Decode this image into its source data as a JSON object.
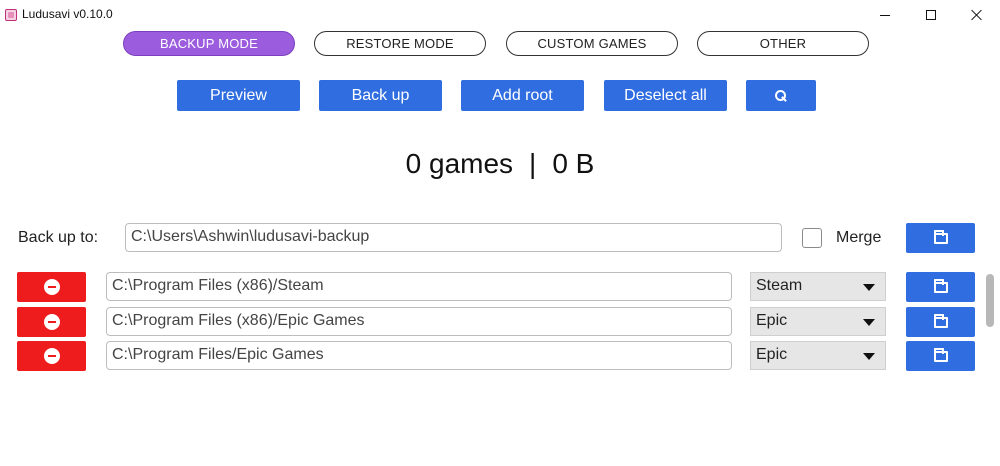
{
  "window": {
    "title": "Ludusavi v0.10.0",
    "icons": {
      "app": "app-icon",
      "minimize": "minimize-icon",
      "maximize": "maximize-icon",
      "close": "close-icon"
    }
  },
  "modes": [
    {
      "label": "BACKUP MODE",
      "active": true
    },
    {
      "label": "RESTORE MODE",
      "active": false
    },
    {
      "label": "CUSTOM GAMES",
      "active": false
    },
    {
      "label": "OTHER",
      "active": false
    }
  ],
  "actions": {
    "preview": "Preview",
    "back_up": "Back up",
    "add_root": "Add root",
    "deselect_all": "Deselect all",
    "search_icon": "search-icon"
  },
  "summary": {
    "games": "0 games",
    "separator": "|",
    "size": "0 B"
  },
  "backup_target": {
    "label": "Back up to:",
    "path": "C:\\Users\\Ashwin\\ludusavi-backup",
    "merge_label": "Merge",
    "merge_checked": false,
    "browse_icon": "folder-icon"
  },
  "roots": [
    {
      "path": "C:\\Program Files (x86)/Steam",
      "store": "Steam"
    },
    {
      "path": "C:\\Program Files (x86)/Epic Games",
      "store": "Epic"
    },
    {
      "path": "C:\\Program Files/Epic Games",
      "store": "Epic"
    }
  ],
  "colors": {
    "accent_purple": "#9b5cdd",
    "button_blue": "#2f6de1",
    "remove_red": "#ee1c1c",
    "select_gray": "#e6e6e6"
  }
}
